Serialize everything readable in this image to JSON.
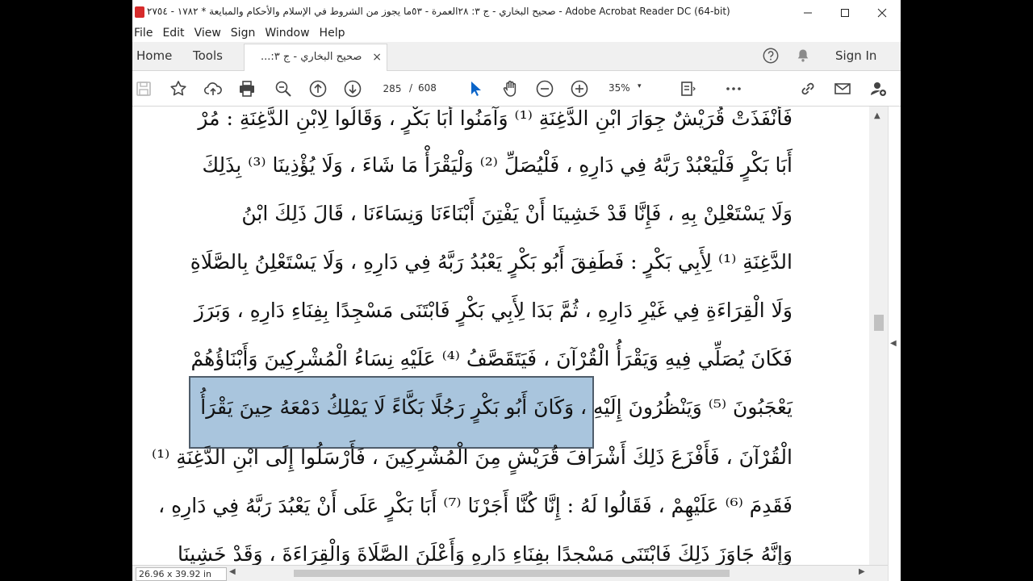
{
  "window": {
    "title": "صحيح البخاري - ج ٣: ٢٨العمرة - ٥٣ما يجوز من الشروط في الإسلام والأحكام والمبايعة * ١٧٨٢ - ٢٧٥٤ - Adobe Acrobat Reader DC (64-bit)"
  },
  "menu": [
    "File",
    "Edit",
    "View",
    "Sign",
    "Window",
    "Help"
  ],
  "tabs": {
    "home": "Home",
    "tools": "Tools",
    "document": "صحيح البخاري - ج ٣:...",
    "close_glyph": "×",
    "signin": "Sign In"
  },
  "toolbar": {
    "current_page": "285",
    "page_separator": "/",
    "total_pages": "608",
    "zoom": "35%",
    "zoom_dropdown": "▾"
  },
  "document": {
    "lines": [
      "فَأَنْفَذَتْ قُرَيْشٌ جِوَارَ ابْنِ الدَّغِنَةِ ⁽¹⁾ وَآمَنُوا أَبَا بَكْرٍ ، وَقَالُوا لِابْنِ الدَّغِنَةِ : مُرْ",
      "أَبَا بَكْرٍ فَلْيَعْبُدْ رَبَّهُ فِي دَارِهِ ، فَلْيُصَلِّ ⁽²⁾ وَلْيَقْرَأْ مَا شَاءَ ، وَلَا يُؤْذِينَا ⁽³⁾ بِذَلِكَ",
      "وَلَا يَسْتَعْلِنْ بِهِ ، فَإِنَّا قَدْ خَشِينَا أَنْ يَفْتِنَ أَبْنَاءَنَا وَنِسَاءَنَا ، قَالَ ذَلِكَ ابْنُ",
      "الدَّغِنَةِ ⁽¹⁾ لِأَبِي بَكْرٍ : فَطَفِقَ أَبُو بَكْرٍ يَعْبُدُ رَبَّهُ فِي دَارِهِ ، وَلَا يَسْتَعْلِنُ بِالصَّلَاةِ",
      "وَلَا الْقِرَاءَةِ فِي غَيْرِ دَارِهِ ، ثُمَّ بَدَا لِأَبِي بَكْرٍ فَابْتَنَى مَسْجِدًا بِفِنَاءِ دَارِهِ ، وَبَرَزَ",
      "فَكَانَ يُصَلِّي فِيهِ وَيَقْرَأُ الْقُرْآنَ ، فَيَتَقَصَّفُ ⁽⁴⁾ عَلَيْهِ نِسَاءُ الْمُشْرِكِينَ وَأَبْنَاؤُهُمْ",
      "يَعْجَبُونَ ⁽⁵⁾ وَيَنْظُرُونَ إِلَيْهِ ، وَكَانَ أَبُو بَكْرٍ رَجُلًا بَكَّاءً لَا يَمْلِكُ دَمْعَهُ حِينَ يَقْرَأُ",
      "الْقُرْآنَ ، فَأَفْزَعَ ذَلِكَ أَشْرَافَ قُرَيْشٍ مِنَ الْمُشْرِكِينَ ، فَأَرْسَلُوا إِلَى ابْنِ الدَّغِنَةِ ⁽¹⁾",
      "فَقَدِمَ ⁽⁶⁾ عَلَيْهِمْ ، فَقَالُوا لَهُ : إِنَّا كُنَّا أَجَرْنَا ⁽⁷⁾ أَبَا بَكْرٍ عَلَى أَنْ يَعْبُدَ رَبَّهُ فِي دَارِهِ ،",
      "وَإِنَّهُ جَاوَزَ ذَلِكَ فَابْتَنَى مَسْجِدًا بِفِنَاءِ دَارِهِ وَأَعْلَنَ الصَّلَاةَ وَالْقِرَاءَةَ ، وَقَدْ خَشِينَا"
    ]
  },
  "status": {
    "page_dimensions": "26.96 x 39.92 in"
  },
  "icons": {
    "app": "acrobat-icon",
    "help": "help-icon",
    "notifications": "bell-icon"
  },
  "colors": {
    "accent": "#0a64c8",
    "highlight": "#8cb2d2",
    "brand_red": "#d62b2b"
  }
}
